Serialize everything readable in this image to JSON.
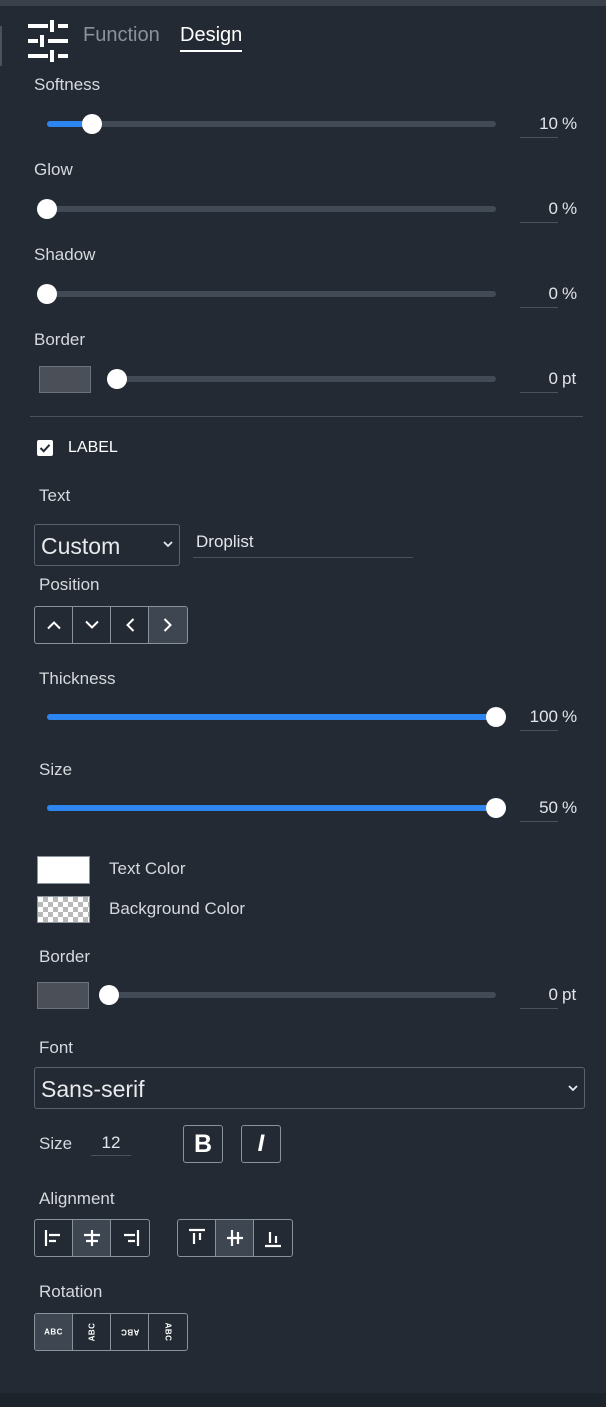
{
  "tabs": {
    "function": "Function",
    "design": "Design",
    "active": "Design"
  },
  "design_top": {
    "softness": {
      "label": "Softness",
      "value": "10",
      "unit": "%",
      "fill_fraction": 0.1
    },
    "glow": {
      "label": "Glow",
      "value": "0",
      "unit": "%",
      "fill_fraction": 0.0
    },
    "shadow": {
      "label": "Shadow",
      "value": "0",
      "unit": "%",
      "fill_fraction": 0.0
    },
    "border": {
      "label": "Border",
      "value": "0",
      "unit": "pt",
      "fill_fraction": 0.0,
      "color": "#4a4f58"
    }
  },
  "label_section": {
    "enabled": true,
    "title": "LABEL",
    "text_label": "Text",
    "text_mode": "Custom",
    "text_value": "Droplist",
    "position_label": "Position",
    "position_options": [
      "up",
      "down",
      "left",
      "right"
    ],
    "position_selected": "right",
    "thickness": {
      "label": "Thickness",
      "value": "100",
      "unit": "%",
      "fill_fraction": 1.0
    },
    "size": {
      "label": "Size",
      "value": "50",
      "unit": "%",
      "fill_fraction": 1.0
    },
    "text_color": {
      "label": "Text Color",
      "color": "#ffffff"
    },
    "background_color": {
      "label": "Background Color",
      "color": "transparent"
    },
    "border": {
      "label": "Border",
      "value": "0",
      "unit": "pt",
      "fill_fraction": 0.0,
      "color": "#4a4f58"
    },
    "font_label": "Font",
    "font_value": "Sans-serif",
    "size_label": "Size",
    "size_value": "12",
    "bold_label": "B",
    "italic_label": "I",
    "alignment_label": "Alignment",
    "horizontal_alignment": [
      "left",
      "center",
      "right"
    ],
    "horizontal_selected": "center",
    "vertical_alignment": [
      "top",
      "middle",
      "bottom"
    ],
    "vertical_selected": "middle",
    "rotation_label": "Rotation",
    "rotation_options": [
      "ABC",
      "ABC",
      "ABC",
      "ABC"
    ],
    "rotation_selected": 0
  },
  "colors": {
    "accent": "#2d86f0",
    "panel": "#232a33",
    "track": "#424a55"
  }
}
